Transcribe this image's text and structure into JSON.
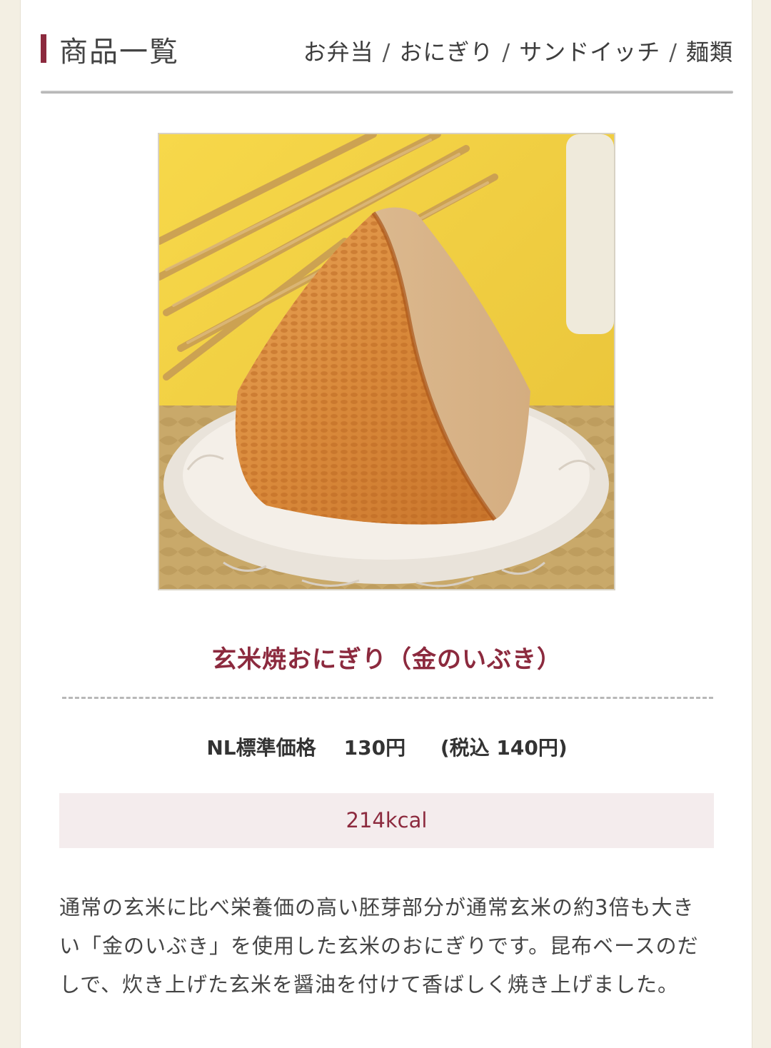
{
  "header": {
    "title": "商品一覧",
    "categories": [
      "お弁当",
      "おにぎり",
      "サンドイッチ",
      "麺類"
    ],
    "separator": "/"
  },
  "product": {
    "name": "玄米焼おにぎり（金のいぶき）",
    "price_label": "NL標準価格",
    "price": "130円",
    "tax_included": "(税込 140円)",
    "calories": "214kcal",
    "description": "通常の玄米に比べ栄養価の高い胚芽部分が通常玄米の約3倍も大きい「金のいぶき」を使用した玄米のおにぎりです。昆布ベースのだしで、炊き上げた玄米を醤油を付けて香ばしく焼き上げました。"
  },
  "colors": {
    "accent": "#8c2a3e",
    "kcal_bg": "#f4eced",
    "page_bg": "#f3efe3"
  },
  "icons": {
    "header_marker": "vertical-bar"
  }
}
